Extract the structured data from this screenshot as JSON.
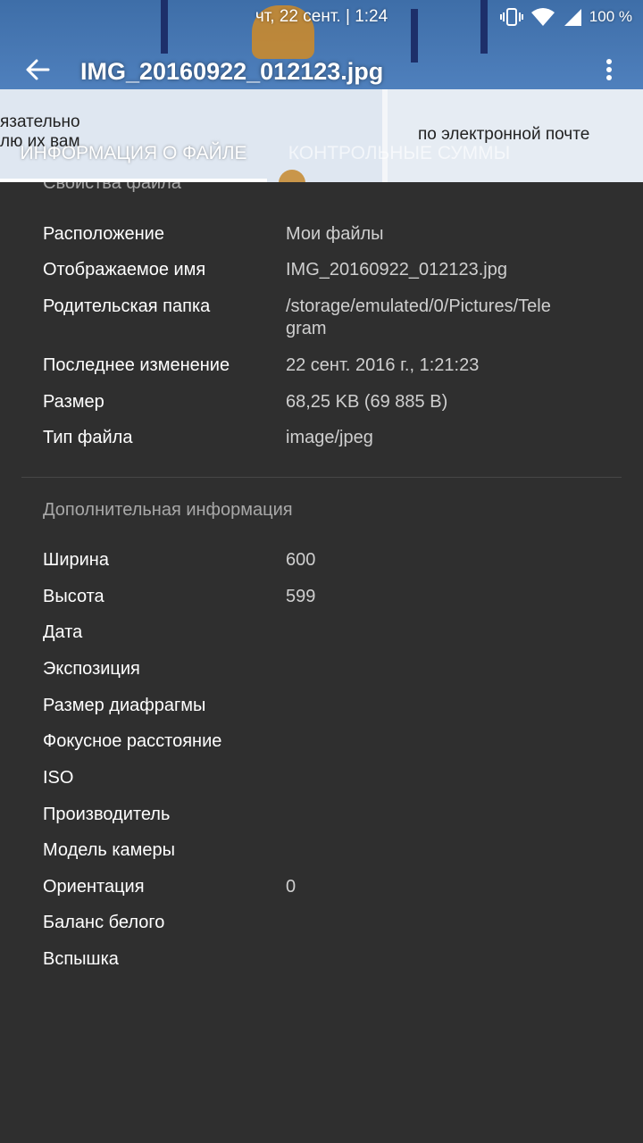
{
  "status_bar": {
    "datetime": "чт, 22 сент. | 1:24",
    "battery": "100 %",
    "icons": [
      "vibrate-icon",
      "wifi-icon",
      "signal-icon"
    ]
  },
  "app_bar": {
    "title": "IMG_20160922_012123.jpg"
  },
  "background_photo_text": {
    "left": "язательно\nлю их вам",
    "right": "по электронной почте"
  },
  "tabs": [
    {
      "label": "ИНФОРМАЦИЯ О ФАЙЛЕ",
      "selected": true
    },
    {
      "label": "КОНТРОЛЬНЫЕ СУММЫ",
      "selected": false
    }
  ],
  "file_properties": {
    "title": "Свойства файла",
    "rows": [
      {
        "label": "Расположение",
        "value": "Мои файлы"
      },
      {
        "label": "Отображаемое имя",
        "value": "IMG_20160922_012123.jpg"
      },
      {
        "label": "Родительская папка",
        "value": "/storage/emulated/0/Pictures/Telegram"
      },
      {
        "label": "Последнее изменение",
        "value": "22 сент. 2016 г., 1:21:23"
      },
      {
        "label": "Размер",
        "value": "68,25 KB (69 885 B)"
      },
      {
        "label": "Тип файла",
        "value": "image/jpeg"
      }
    ]
  },
  "additional_info": {
    "title": "Дополнительная информация",
    "rows": [
      {
        "label": "Ширина",
        "value": "600"
      },
      {
        "label": "Высота",
        "value": "599"
      },
      {
        "label": "Дата",
        "value": ""
      },
      {
        "label": "Экспозиция",
        "value": ""
      },
      {
        "label": "Размер диафрагмы",
        "value": ""
      },
      {
        "label": "Фокусное расстояние",
        "value": ""
      },
      {
        "label": "ISO",
        "value": ""
      },
      {
        "label": "Производитель",
        "value": ""
      },
      {
        "label": "Модель камеры",
        "value": ""
      },
      {
        "label": "Ориентация",
        "value": "0"
      },
      {
        "label": "Баланс белого",
        "value": ""
      },
      {
        "label": "Вспышка",
        "value": ""
      }
    ]
  },
  "colors": {
    "background": "#2f2f2f",
    "section_title": "#a8a8a8",
    "label": "#ffffff",
    "value": "#cfcfcf"
  }
}
